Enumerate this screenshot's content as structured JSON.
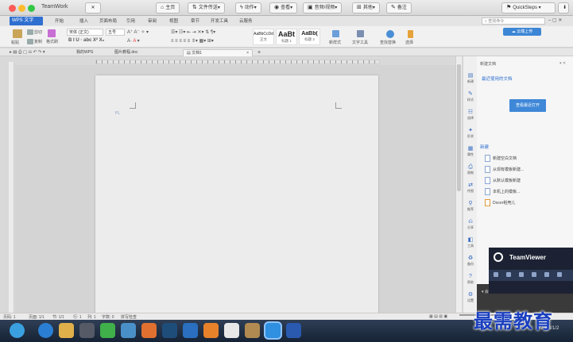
{
  "mac": {
    "app_title": "TeamWork",
    "toolbar": [
      {
        "label": "主页",
        "icon": "home-icon"
      },
      {
        "label": "文件传送",
        "icon": "file-transfer-icon"
      },
      {
        "label": "动作",
        "icon": "bolt-icon"
      },
      {
        "label": "查看",
        "icon": "eye-icon"
      },
      {
        "label": "音频/视频",
        "icon": "chat-icon"
      },
      {
        "label": "其他",
        "icon": "more-icon"
      },
      {
        "label": "备注",
        "icon": "note-icon"
      }
    ],
    "quicksteps": "QuickSteps",
    "close_glyph": "✕"
  },
  "wps": {
    "logo": "WPS 文字",
    "tabs": [
      "开始",
      "插入",
      "页面布局",
      "引用",
      "审阅",
      "视图",
      "章节",
      "开发工具",
      "云服务"
    ],
    "active_tab": "开始",
    "search_placeholder": "查找命令",
    "cloud_button": "云端上传",
    "ribbon": {
      "paste": "粘贴",
      "cut": "剪切",
      "copy": "复制",
      "format_painter": "格式刷",
      "font_name": "宋体 (正文)",
      "font_size": "五号",
      "styles": [
        {
          "sample": "AaBbCcDd",
          "name": "正文"
        },
        {
          "sample": "AaBt",
          "name": "标题 1"
        },
        {
          "sample": "AaBb(",
          "name": "标题 2"
        }
      ],
      "new_style": "新样式",
      "text_tools": "文字工具",
      "find_replace": "查找替换",
      "select": "选择"
    },
    "doc_tabs": [
      {
        "label": "我的WPS"
      },
      {
        "label": "图片教程.doc"
      },
      {
        "label": "文档1",
        "active": true
      }
    ],
    "page_marker": "PL"
  },
  "side_icons": [
    {
      "glyph": "▤",
      "label": "新建"
    },
    {
      "glyph": "✎",
      "label": "样式"
    },
    {
      "glyph": "☷",
      "label": "选择"
    },
    {
      "glyph": "✦",
      "label": "形状"
    },
    {
      "glyph": "▦",
      "label": "属性"
    },
    {
      "glyph": "⎙",
      "label": "限制"
    },
    {
      "glyph": "⇄",
      "label": "传图"
    },
    {
      "glyph": "⚲",
      "label": "推荐"
    },
    {
      "glyph": "⎌",
      "label": "分享"
    },
    {
      "glyph": "◧",
      "label": "工具"
    },
    {
      "glyph": "♻",
      "label": "备份"
    },
    {
      "glyph": "?",
      "label": "帮助"
    },
    {
      "glyph": "⚙",
      "label": "设置"
    }
  ],
  "task_pane": {
    "header": "新建文档",
    "recent_link": "最近使用的文档",
    "open_button": "查看最近打开",
    "new_section": "新建",
    "items": [
      "新建空白文档",
      "从现有模板新建...",
      "从默认模板新建",
      "本机上的模板...",
      "Docer稻壳儿"
    ]
  },
  "teamviewer": {
    "name": "TeamViewer",
    "panel_title": "会话列表"
  },
  "status": {
    "page": "页码: 1",
    "pages": "页面: 1/1",
    "section": "节: 1/1",
    "row": "行: 1",
    "column": "列: 1",
    "words": "字数: 0",
    "spell": "拼写检查"
  },
  "taskbar": {
    "icons": [
      {
        "name": "start-orb-icon",
        "color": "#3aa0e0"
      },
      {
        "name": "ie-icon",
        "color": "#2a7fd4"
      },
      {
        "name": "folder-icon",
        "color": "#e0b04a"
      },
      {
        "name": "media-icon",
        "color": "#555a66"
      },
      {
        "name": "qq-browser-icon",
        "color": "#3fb04a"
      },
      {
        "name": "network-icon",
        "color": "#4a90c8"
      },
      {
        "name": "basketball-icon",
        "color": "#e07030"
      },
      {
        "name": "photoshop-icon",
        "color": "#1f4d7a"
      },
      {
        "name": "globe-icon",
        "color": "#2a6fc0"
      },
      {
        "name": "firefox-icon",
        "color": "#e8822a"
      },
      {
        "name": "qq-icon",
        "color": "#e8e8e8"
      },
      {
        "name": "game-icon",
        "color": "#b08a50"
      },
      {
        "name": "wps-writer-icon",
        "color": "#2f8fe0"
      },
      {
        "name": "teamviewer-icon",
        "color": "#2a5ab0"
      }
    ],
    "tray": "2018/1/2"
  },
  "watermark": "最需教育",
  "colors": {
    "accent": "#2f6fd0",
    "taskbar": "#1c2a3e",
    "teamviewer": "#1c2233"
  }
}
